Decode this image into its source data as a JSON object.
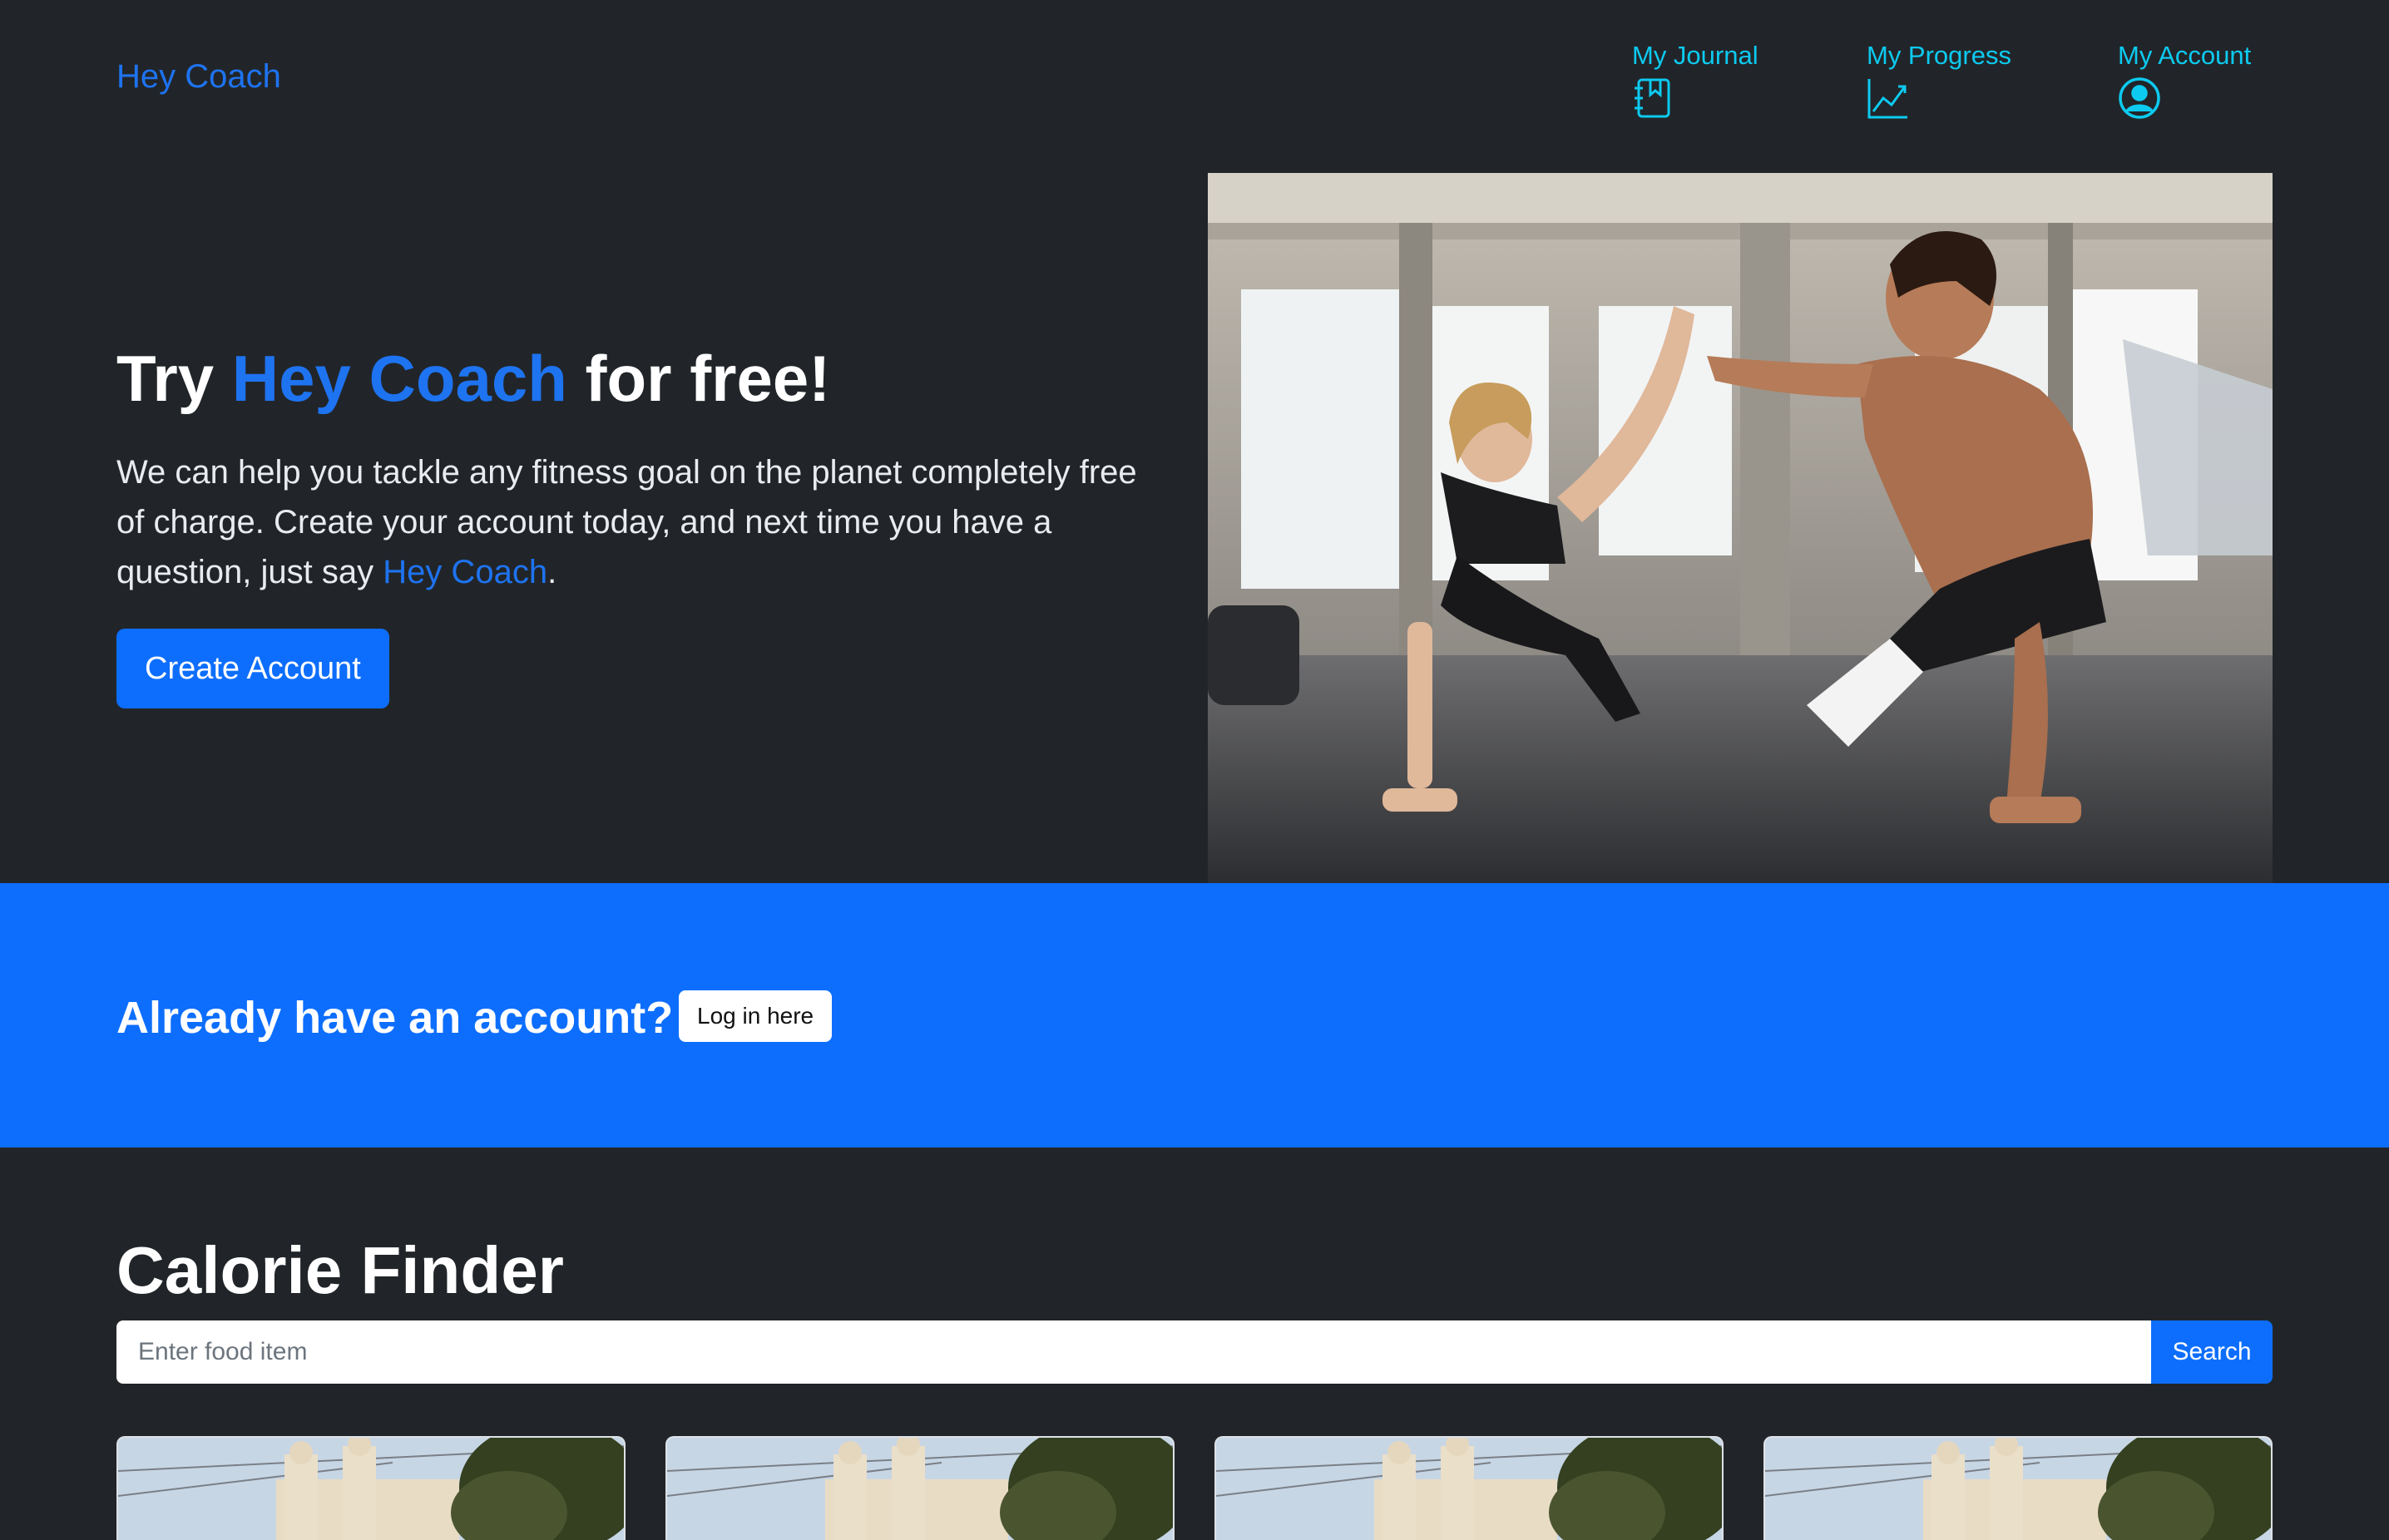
{
  "navbar": {
    "brand": "Hey Coach",
    "items": [
      {
        "label": "My Journal",
        "icon": "journal-bookmark-icon"
      },
      {
        "label": "My Progress",
        "icon": "graph-up-icon"
      },
      {
        "label": "My Account",
        "icon": "person-circle-icon"
      }
    ]
  },
  "hero": {
    "title_prefix": "Try ",
    "title_accent": "Hey Coach",
    "title_suffix": " for free!",
    "text_main": "We can help you tackle any fitness goal on the planet completely free of charge. Create your account today, and next time you have a question, just say ",
    "text_link": "Hey Coach",
    "text_end": ".",
    "cta_label": "Create Account",
    "image": "fitness-high-five-photo"
  },
  "login": {
    "title": "Already have an account?",
    "button_label": "Log in here"
  },
  "calorie_finder": {
    "title": "Calorie Finder",
    "placeholder": "Enter food item",
    "search_label": "Search",
    "cards": [
      {
        "image": "building-photo"
      },
      {
        "image": "building-photo"
      },
      {
        "image": "building-photo"
      },
      {
        "image": "building-photo"
      }
    ]
  },
  "colors": {
    "background": "#212529",
    "primary": "#0d6efd",
    "brand_link": "#1e73f0",
    "nav_cyan": "#0dcaf0"
  }
}
